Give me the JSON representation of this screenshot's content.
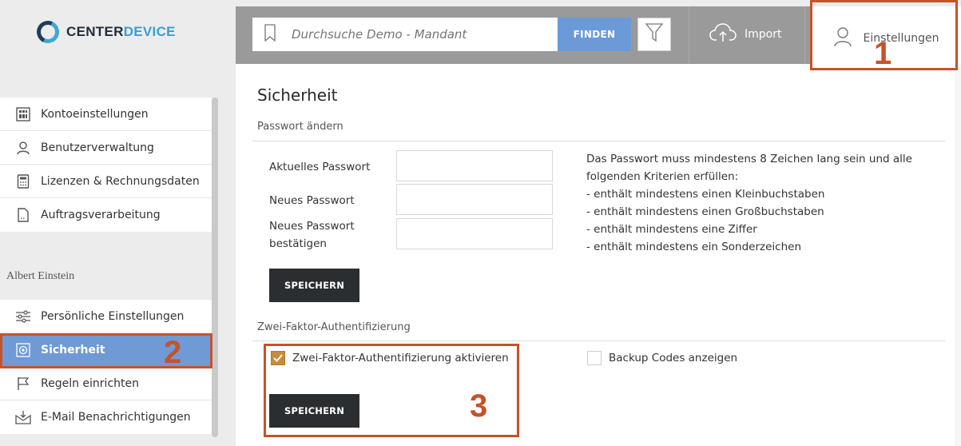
{
  "brand": {
    "prefix": "CENTER",
    "suffix": "DEVICE"
  },
  "sidebar": {
    "account_items": [
      {
        "label": "Kontoeinstellungen",
        "icon": "grid-icon"
      },
      {
        "label": "Benutzerverwaltung",
        "icon": "user-icon"
      },
      {
        "label": "Lizenzen & Rechnungsdaten",
        "icon": "calculator-icon"
      },
      {
        "label": "Auftragsverarbeitung",
        "icon": "document-icon"
      }
    ],
    "user_name": "Albert Einstein",
    "user_items": [
      {
        "label": "Persönliche Einstellungen",
        "icon": "sliders-icon"
      },
      {
        "label": "Sicherheit",
        "icon": "shield-icon",
        "active": true
      },
      {
        "label": "Regeln einrichten",
        "icon": "flag-icon"
      },
      {
        "label": "E-Mail Benachrichtigungen",
        "icon": "mail-icon"
      }
    ]
  },
  "topbar": {
    "search_placeholder": "Durchsuche Demo - Mandant",
    "find_label": "FINDEN",
    "import_label": "Import",
    "settings_label": "Einstellungen"
  },
  "main": {
    "title": "Sicherheit",
    "password_section": "Passwort ändern",
    "current_password_label": "Aktuelles Passwort",
    "new_password_label": "Neues Passwort",
    "confirm_password_label_1": "Neues Passwort",
    "confirm_password_label_2": "bestätigen",
    "rules": [
      "Das Passwort muss mindestens 8 Zeichen lang sein und alle",
      "folgenden Kriterien erfüllen:",
      "- enthält mindestens einen Kleinbuchstaben",
      "- enthält mindestens einen Großbuchstaben",
      "- enthält mindestens eine Ziffer",
      "- enthält mindestens ein Sonderzeichen"
    ],
    "save_label": "SPEICHERN",
    "twofa_section": "Zwei-Faktor-Authentifizierung",
    "twofa_checkbox_label": "Zwei-Faktor-Authentifizierung aktivieren",
    "twofa_checked": true,
    "backup_codes_label": "Backup Codes anzeigen",
    "backup_codes_checked": false,
    "save2_label": "SPEICHERN"
  },
  "annotations": {
    "one": "1",
    "two": "2",
    "three": "3"
  },
  "colors": {
    "accent": "#6f9ad6",
    "annotation": "#c5532a",
    "checkbox": "#c98a3a",
    "topbar": "#9a9a9a"
  }
}
